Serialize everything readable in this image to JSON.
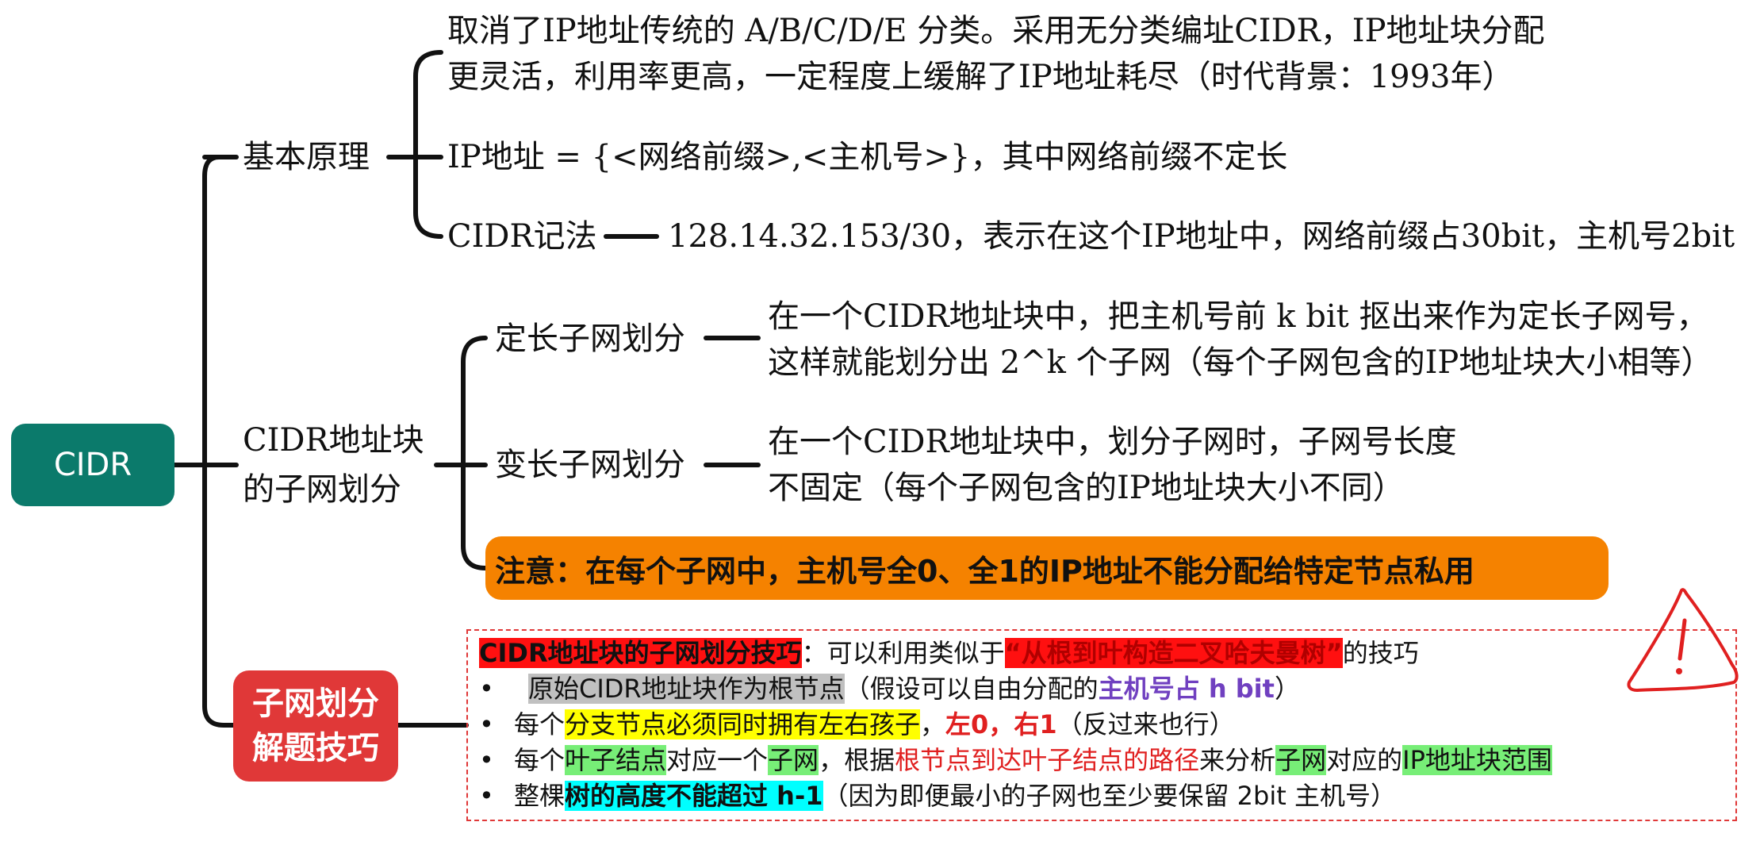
{
  "root": {
    "label": "CIDR"
  },
  "basic": {
    "label": "基本原理",
    "item1": {
      "line1": "取消了IP地址传统的 A/B/C/D/E 分类。采用无分类编址CIDR，IP地址块分配",
      "line2": "更灵活，利用率更高，一定程度上缓解了IP地址耗尽（时代背景：1993年）"
    },
    "item2": "IP地址 = {<网络前缀>,<主机号>}，其中网络前缀不定长",
    "item3": {
      "label": "CIDR记法",
      "detail": "128.14.32.153/30，表示在这个IP地址中，网络前缀占30bit，主机号2bit"
    }
  },
  "subnet": {
    "label_line1": "CIDR地址块",
    "label_line2": "的子网划分",
    "fixed": {
      "label": "定长子网划分",
      "line1": "在一个CIDR地址块中，把主机号前 k bit 抠出来作为定长子网号，",
      "line2": "这样就能划分出 2^k 个子网（每个子网包含的IP地址块大小相等）"
    },
    "variable": {
      "label": "变长子网划分",
      "line1": "在一个CIDR地址块中，划分子网时，子网号长度",
      "line2": "不固定（每个子网包含的IP地址块大小不同）"
    },
    "note": "注意：在每个子网中，主机号全0、全1的IP地址不能分配给特定节点私用"
  },
  "tips": {
    "label_line1": "子网划分",
    "label_line2": "解题技巧",
    "title": {
      "hl": "CIDR地址块的子网划分技巧",
      "mid": "：可以利用类似于",
      "quote": "“从根到叶构造二叉哈夫曼树”",
      "tail": "的技巧"
    },
    "bullet_char": "•",
    "b1": {
      "hl": "原始CIDR地址块作为根节点",
      "mid": "（假设可以自由分配的",
      "purple": "主机号占 h bit",
      "tail": "）"
    },
    "b2": {
      "pre": "每个",
      "hl": "分支节点必须同时拥有左右孩子",
      "sep": "，",
      "red": "左0，右1",
      "tail": "（反过来也行）"
    },
    "b3": {
      "pre": "每个",
      "hl1": "叶子结点",
      "mid1": "对应一个",
      "hl2": "子网",
      "mid2": "，根据",
      "red": "根节点到达叶子结点的路径",
      "mid3": "来分析",
      "hl3": "子网",
      "mid4": "对应的",
      "hl4": "IP地址块范围"
    },
    "b4": {
      "pre": "整棵",
      "hl": "树的高度不能超过 h-1",
      "tail": "（因为即便最小的子网也至少要保留 2bit 主机号）"
    }
  },
  "warning": {
    "symbol": "!"
  },
  "colors": {
    "root": "#0b7a6b",
    "tips_node": "#e03838",
    "note": "#f58200",
    "connector": "#111111",
    "warning": "#e02020"
  },
  "icons": [
    "warning-icon"
  ]
}
